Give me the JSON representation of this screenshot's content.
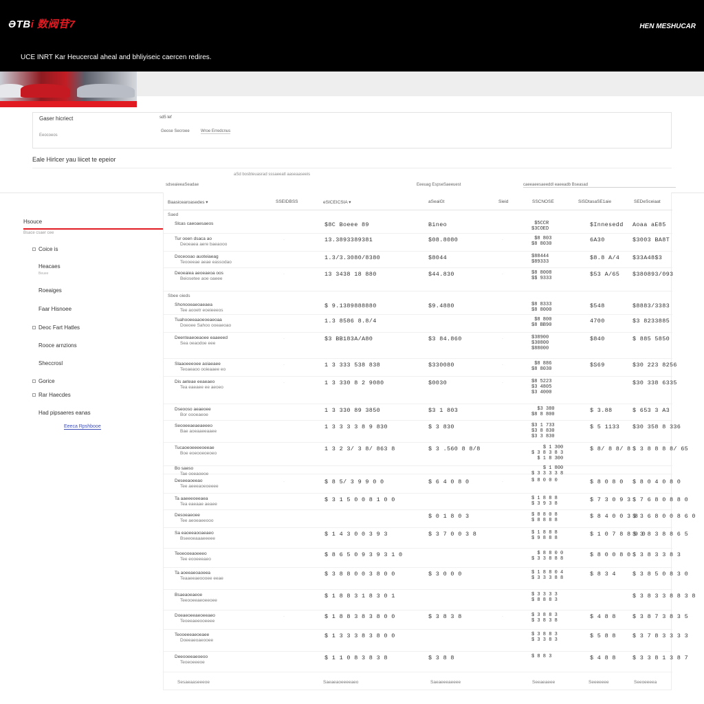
{
  "header": {
    "logo_main": "ƏTB",
    "logo_accent": "i 数阀苷7",
    "right_label": "HEN MESHUCAR",
    "tagline": "UCE INRT Kar Heucercal aheal and bhliyiseic caercen redires."
  },
  "filter": {
    "label": "Gaser hicriect",
    "code": "sd5 lef",
    "sub": "Eeocoeos",
    "option1": "Geose Secroee",
    "option2": "Wroe Erredcnus"
  },
  "prompt": "Eale Hirlcer yau liicet te epeior",
  "search_hint": "aSd bosbteuasrad sssaeeatl aaseaaseeis",
  "group_headers": [
    "sdseaieeaSeadae",
    "Eeeuag EspseSaeeuest",
    "caeeaeesaeeddl eaeeadb Bseasad"
  ],
  "sidebar": {
    "title": "Hsouce",
    "subtitle": "Bsace csaer cee",
    "items": [
      {
        "label": "Coice is",
        "box": true
      },
      {
        "label": "Heacaes",
        "box": false,
        "sub": "Beuee"
      },
      {
        "label": "Roeaiges",
        "box": false
      },
      {
        "label": "Faar Hisnoee",
        "box": false
      },
      {
        "label": "Deoc Fart Hatles",
        "box": true
      },
      {
        "label": "Rooce arnzions",
        "box": false
      },
      {
        "label": "Sheccrosl",
        "box": false
      },
      {
        "label": "Gorice",
        "box": true
      },
      {
        "label": "Rar Haecdes",
        "box": true
      },
      {
        "label": "Had pipsaeres eanas",
        "box": false
      }
    ],
    "link": "Eeeca Rpshbooe"
  },
  "table": {
    "headers": [
      "Baasicearoasedes ▾",
      "SSEIDBSS",
      "eSICEICSIA ▾",
      "aSeaiGt",
      "Sieid",
      "SSCNOSE",
      "SiSDtasaSE1aie",
      "SEDeSceiaat"
    ],
    "sections": [
      {
        "label": "Saed",
        "row_index": 0
      },
      {
        "label": "Sbee oieds",
        "row_index": 4
      }
    ],
    "rows": [
      {
        "name1": "Slcas caeoaesaeos",
        "name2": "",
        "c2": "$8C Boeee 89",
        "c3": "Bineo",
        "tick": "",
        "s1": [
          "$5CCR",
          "$3COED"
        ],
        "c5": "$Innesedd",
        "c6": "Aoaa aE85"
      },
      {
        "name1": "Tur ooen dsaca ao",
        "name2": "Deoeaea aere baeaooo",
        "c2": "13.3893389381",
        "c3": "$08.8080",
        "tick": "·",
        "s1": [
          "$8 803",
          "$8 8030"
        ],
        "c5": "6A30",
        "c6": "$3003 BA8T"
      },
      {
        "name1": "Doceooao auoteiaeag",
        "name2": "Teooeeae aeae eassodao",
        "c2": "1.3/3.3080/8380",
        "c3": "$8044",
        "tick": "",
        "s1": [
          "$88444",
          "$89333"
        ],
        "c5": "$8.8 A/4",
        "c6": "$33A48$3"
      },
      {
        "name1": "Deoeaiea aeoeaeoa oos",
        "name2": "Beiosetee aoe oaeee",
        "c2": "13 3438 18 880",
        "c3": "$44.830",
        "tick": "·",
        "s1": [
          "$8 8008",
          "$$ 9333"
        ],
        "c5": "$53 A/65",
        "c6": "$380893/093"
      },
      {
        "name1": "Shonooeaeoaeaea",
        "name2": "Tee aooetr eoeieeeos",
        "c2": "$ 9.1389888880",
        "c3": "$9.4880",
        "tick": "",
        "s1": [
          "$8 8333",
          "$8 8000"
        ],
        "c5": "$548",
        "c6": "$8883/3383"
      },
      {
        "name1": "Tuahooeeaaoeoeaeoaa",
        "name2": "Doeoee Sahoo ooeaeoao",
        "c2": "1.3 8586 8.8/4",
        "c3": "",
        "tick": "",
        "s1": [
          "$8 800",
          "$8 BB90"
        ],
        "c5": "4700",
        "c6": "$3 8233885"
      },
      {
        "name1": "Deenteaeoeaoee eaaeeed",
        "name2": "Sea oeaodoe eee",
        "c2": "$3 BB183A/A80",
        "c3": "$3 84.860",
        "tick": "·",
        "s1": [
          "$38900",
          "$30800",
          "$88000"
        ],
        "c5": "$840",
        "c6": "$ 885 5850"
      },
      {
        "name1": "Slaaoeeeoee aoiaeaee",
        "name2": "Teoaeaoo ooieaaee eo",
        "c2": "1 3 333 538 838",
        "c3": "$330080",
        "tick": "·",
        "s1": [
          "$8 886",
          "$8 8030"
        ],
        "c5": "$S69",
        "c6": "$30 223 8256"
      },
      {
        "name1": "Dis aeteae eeaeaeo",
        "name2": "Tea eaeaee ee aeoeo",
        "c2": "1 3 330 8 2 9080",
        "c3": "$0030",
        "tick": "·",
        "s1": [
          "$8 5223",
          "$3 4805",
          "$3 4000"
        ],
        "c5": "",
        "c6": "$30 338 6335"
      },
      {
        "name1": "Dseooso aeaeoee",
        "name2": "Bor oooeaeoe",
        "c2": "1 3 330 89 3850",
        "c3": "$3 1 803",
        "tick": "",
        "s1": [
          "$3 380",
          "$8 8 800"
        ],
        "c5": "$ 3.88",
        "c6": "$ 653 3 A3"
      },
      {
        "name1": "Seooeeaeaeaeeeo",
        "name2": "Bae aoeaaeeaaee",
        "c2": "1 3 3 3 3 8 9 830",
        "c3": "$ 3 830",
        "tick": "",
        "s1": [
          "$3 1 733",
          "$3 8 830",
          "$3 3 830"
        ],
        "c5": "$ 5 1133",
        "c6": "$30 358 8 336"
      },
      {
        "name1": "Tucaoeoeeeeoeeae",
        "name2": "Boe eoeooeoeoeo",
        "c2": "1 3 2 3/ 3 8/ 863 8",
        "c3": "$ 3 .560 8 8/8",
        "tick": "",
        "s1": [
          "$ 1 300",
          "$ 3 8 3 8 3",
          "$ 1 8 300"
        ],
        "c5": "$ 8/ 8 8/ 8",
        "c6": "$ 3 8 8 8 8/ 65"
      },
      {
        "name1": "Bo saeso",
        "name2": "Tae ooeaoeoe",
        "c2": "",
        "c3": "",
        "tick": "",
        "s1": [
          "$ 1 800",
          "$ 3 3 3 3 8"
        ],
        "c5": "",
        "c6": ""
      },
      {
        "name1": "Deseeaoeeao",
        "name2": "Tee aeeeaoeoeeee",
        "c2": "$ 8 5/ 3 9 9 0 0",
        "c3": "$ 6 4 0 8 0",
        "tick": "·",
        "s1": [
          "$ 8 0 0 0"
        ],
        "c5": "$ 8 0 8 0",
        "c6": "$ 8 0 4 0 8 0"
      },
      {
        "name1": "Ta aaeeeoeeaea",
        "name2": "Tea eaeaae aeaee",
        "c2": "$ 3 1 5 0 0 8 1 0 0",
        "c3": "",
        "tick": "",
        "s1": [
          "$ 1 8 8 8",
          "$ 3 9 3 8"
        ],
        "c5": "$ 7 3 0 9 3",
        "c6": "$ 7 6 8 0 8 8 0"
      },
      {
        "name1": "Desoeaeoee",
        "name2": "Tee aeoeaeeooo",
        "c2": "",
        "c3": "$ 0 1 8 0 3",
        "tick": "",
        "s1": [
          "$ 8 8 0 8",
          "$ 8 8 8 8"
        ],
        "c5": "$ 8 4 0 0 3 8",
        "c6": "$ 3 6 8 0 0 8 6 0"
      },
      {
        "name1": "Sa eaoeeaooaeaeo",
        "name2": "Bseeoeaaaeeeee",
        "c2": "$ 1 4 3 0 0 3 9 3",
        "c3": "$ 3 7 0 0 3 8",
        "tick": "",
        "s1": [
          "$ 1 8 8 8",
          "$ 9 8 8 8"
        ],
        "c5": "$ 1 0 7 8 8 9 0",
        "c6": "$ 3 8 3 8 8 6 5"
      },
      {
        "name1": "Teoeooeaoeeeo",
        "name2": "Tee eooeeeaeo",
        "c2": "$ 8 6 5 0 9 3 9 3 1 0",
        "c3": "",
        "tick": "",
        "s1": [
          "$ 8 8 0 0",
          "$ 3 3 8 8 8"
        ],
        "c5": "$ 8 0 0 8 0",
        "c6": "$ 3 8 3 3 8 3"
      },
      {
        "name1": "Ta aoeeaeoaoeea",
        "name2": "Teaaeeaeoooee eeae",
        "c2": "$ 3 8 8 0 0 3 8 0 0",
        "c3": "$ 3 0 0 0",
        "tick": "",
        "s1": [
          "$ 1 8 8 0 4",
          "$ 3 3 3 8 8"
        ],
        "c5": "$ 8 3 4",
        "c6": "$ 3 8 5 0 8 3 0"
      },
      {
        "name1": "Bsaeaoeaeoe",
        "name2": "Teeooeeaeoeeoee",
        "c2": "$ 1 8 8 3 1 8 3 0 1",
        "c3": "",
        "tick": "",
        "s1": [
          "$ 3 3 3 3",
          "$ 8 8 8 3"
        ],
        "c5": "",
        "c6": "$ 3 8 3 3 8 8 3 8"
      },
      {
        "name1": "Doeaeoeeaeoeeaeo",
        "name2": "Teoeeaeeooeeee",
        "c2": "$ 1 8 8 3 8 3 8 0 0",
        "c3": "$ 3 8 3 8",
        "tick": "·",
        "s1": [
          "$ 3 8 8 3",
          "$ 3 8 3 8"
        ],
        "c5": "$ 4 8 8",
        "c6": "$ 3 8 7 3 8 3 5"
      },
      {
        "name1": "Teooeeeaeoeaee",
        "name2": "Doeeaeoaeooee",
        "c2": "$ 1 3 3 3 8 3 8 0 0",
        "c3": "",
        "tick": "",
        "s1": [
          "$ 3 8 8 3",
          "$ 3 3 8 3"
        ],
        "c5": "$ 5 8 8",
        "c6": "$ 3 7 8 3 3 3 3"
      },
      {
        "name1": "Deeooeeaeoeoo",
        "name2": "Teoeoeeeoe",
        "c2": "$ 1 1 0 8 3 8 3 8",
        "c3": "$ 3 8 8",
        "tick": "",
        "s1": [
          "$ 8 8 3"
        ],
        "c5": "$ 4 8 8",
        "c6": "$ 3 3 8 1 3 8 7"
      }
    ],
    "footer": [
      "Sesaeaaseeeoe",
      "Saeaeaoeeeeaeo",
      "Saeaeeeaeeee",
      "Seeaeaeee",
      "Seeeeeee",
      "Seeoeeeea"
    ]
  }
}
